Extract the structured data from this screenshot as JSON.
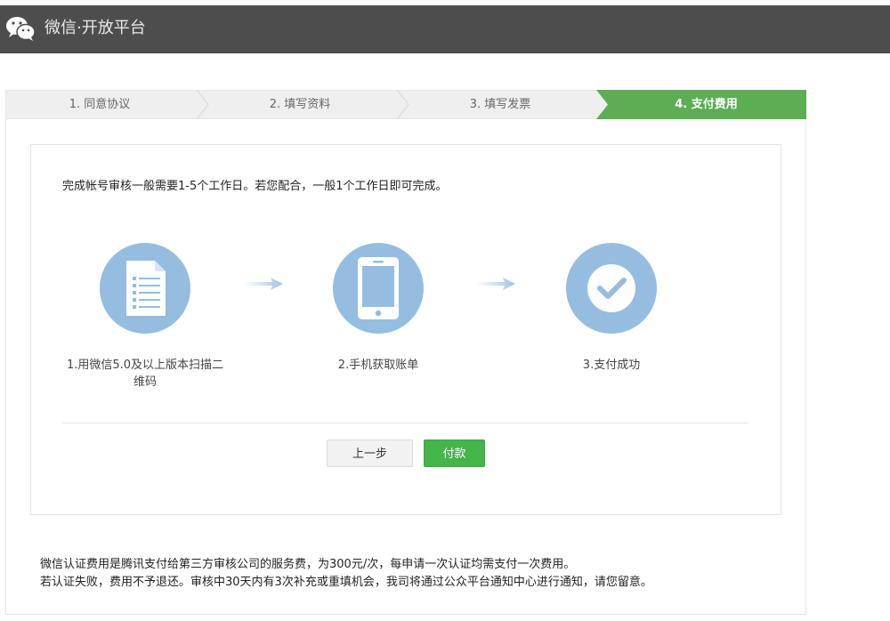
{
  "header": {
    "title": "微信·开放平台",
    "logo_icon": "wechat-logo-icon"
  },
  "steps": [
    {
      "label": "1. 同意协议",
      "active": false
    },
    {
      "label": "2. 填写资料",
      "active": false
    },
    {
      "label": "3. 填写发票",
      "active": false
    },
    {
      "label": "4. 支付费用",
      "active": true
    }
  ],
  "main": {
    "intro": "完成帐号审核一般需要1-5个工作日。若您配合，一般1个工作日即可完成。",
    "process": [
      {
        "icon": "document-icon",
        "caption_line1": "1.用微信5.0及以上版本扫描二",
        "caption_line2": "维码"
      },
      {
        "icon": "mobile-phone-icon",
        "caption_line1": "2.手机获取账单",
        "caption_line2": ""
      },
      {
        "icon": "checkmark-icon",
        "caption_line1": "3.支付成功",
        "caption_line2": ""
      }
    ],
    "buttons": {
      "prev": "上一步",
      "pay": "付款"
    }
  },
  "footer_note": {
    "line1": "微信认证费用是腾讯支付给第三方审核公司的服务费，为300元/次，每申请一次认证均需支付一次费用。",
    "line2": "若认证失败，费用不予退还。审核中30天内有3次补充或重填机会，我司将通过公众平台通知中心进行通知，请您留意。"
  },
  "colors": {
    "header_bg": "#4d4d4d",
    "step_active": "#5cad54",
    "step_inactive": "#efefef",
    "icon_circle": "#95bde0",
    "pay_button": "#44b549"
  }
}
